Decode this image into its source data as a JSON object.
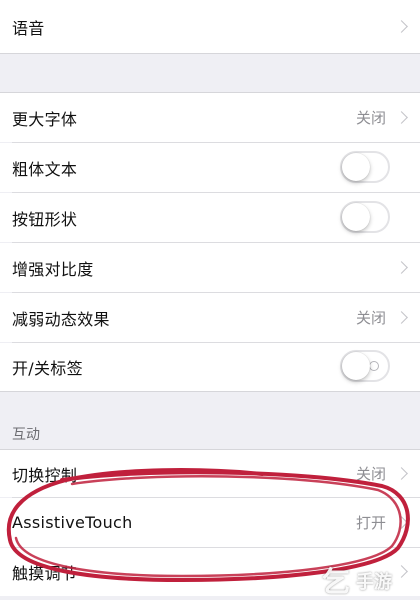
{
  "rows": [
    {
      "label": "语音",
      "value": ""
    },
    {
      "label": "更大字体",
      "value": "关闭"
    },
    {
      "label": "粗体文本"
    },
    {
      "label": "按钮形状"
    },
    {
      "label": "增强对比度",
      "value": ""
    },
    {
      "label": "减弱动态效果",
      "value": "关闭"
    },
    {
      "label": "开/关标签"
    },
    {
      "label": "切换控制",
      "value": "关闭"
    },
    {
      "label": "AssistiveTouch",
      "value": "打开"
    },
    {
      "label": "触摸调节",
      "value": ""
    }
  ],
  "section_header": "互动",
  "toggles": {
    "bold_text": false,
    "button_shapes": false,
    "on_off_labels": false
  },
  "watermark": {
    "text1": "乞",
    "text2": "手游"
  },
  "colors": {
    "annotation": "#c0203c",
    "background": "#efeff4"
  }
}
